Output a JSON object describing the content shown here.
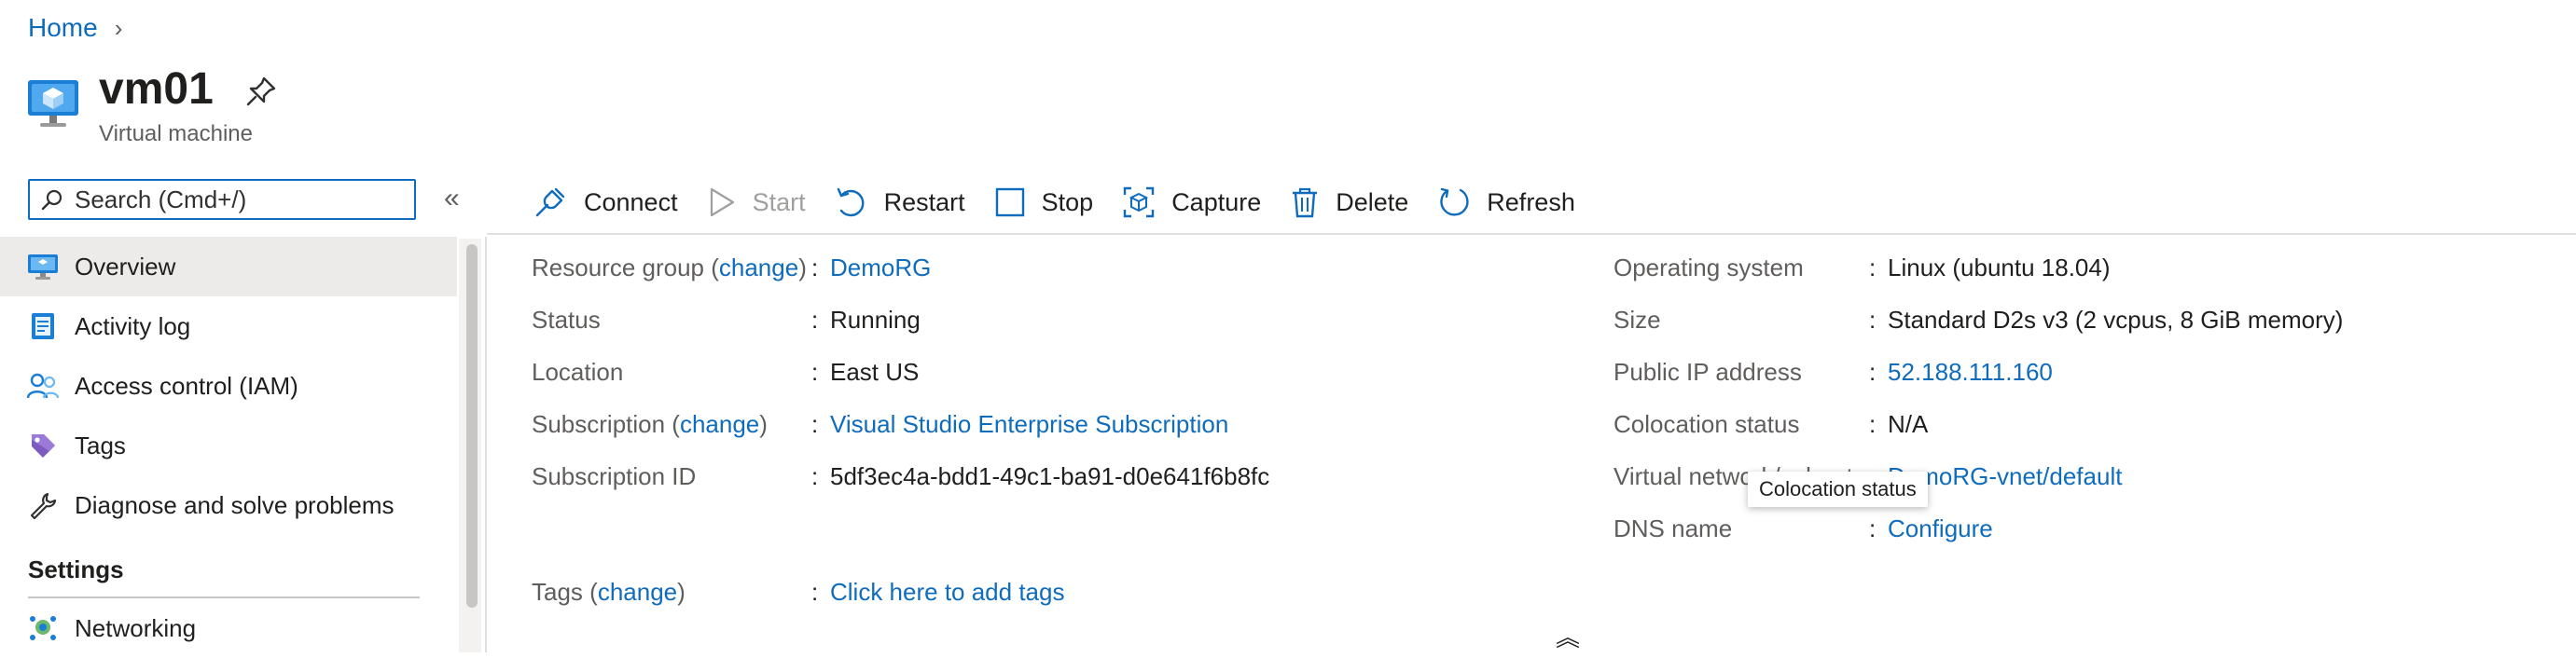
{
  "breadcrumb": {
    "home": "Home",
    "separator": "›"
  },
  "header": {
    "title": "vm01",
    "subtitle": "Virtual machine",
    "icon": "virtual-machine-icon",
    "pin_icon": "pin-icon"
  },
  "search": {
    "placeholder": "Search (Cmd+/)",
    "collapse": "«"
  },
  "sidebar": {
    "items": [
      {
        "label": "Overview",
        "icon": "monitor-icon",
        "active": true
      },
      {
        "label": "Activity log",
        "icon": "log-icon"
      },
      {
        "label": "Access control (IAM)",
        "icon": "people-icon"
      },
      {
        "label": "Tags",
        "icon": "tag-icon"
      },
      {
        "label": "Diagnose and solve problems",
        "icon": "wrench-icon"
      }
    ],
    "section": "Settings",
    "section_items": [
      {
        "label": "Networking",
        "icon": "network-icon"
      }
    ]
  },
  "toolbar": {
    "connect": "Connect",
    "start": "Start",
    "restart": "Restart",
    "stop": "Stop",
    "capture": "Capture",
    "delete": "Delete",
    "refresh": "Refresh"
  },
  "essentials": {
    "left": {
      "resource_group": {
        "label": "Resource group",
        "change": "change",
        "value": "DemoRG"
      },
      "status": {
        "label": "Status",
        "value": "Running"
      },
      "location": {
        "label": "Location",
        "value": "East US"
      },
      "subscription": {
        "label": "Subscription",
        "change": "change",
        "value": "Visual Studio Enterprise Subscription"
      },
      "subscription_id": {
        "label": "Subscription ID",
        "value": "5df3ec4a-bdd1-49c1-ba91-d0e641f6b8fc"
      },
      "tags": {
        "label": "Tags",
        "change": "change",
        "value": "Click here to add tags"
      }
    },
    "right": {
      "os": {
        "label": "Operating system",
        "value": "Linux (ubuntu 18.04)"
      },
      "size": {
        "label": "Size",
        "value": "Standard D2s v3 (2 vcpus, 8 GiB memory)"
      },
      "public_ip": {
        "label": "Public IP address",
        "value": "52.188.111.160"
      },
      "colocation": {
        "label": "Colocation status",
        "value": "N/A"
      },
      "vnet": {
        "label": "Virtual network/subnet",
        "value": "DemoRG-vnet/default"
      },
      "dns": {
        "label": "DNS name",
        "value": "Configure"
      }
    },
    "colon": ":"
  },
  "tooltip": "Colocation status",
  "expand_glyph": "︽",
  "colors": {
    "accent": "#0f6cbd",
    "text": "#201f1e",
    "muted": "#605e5c",
    "active_bg": "#edebe9"
  }
}
